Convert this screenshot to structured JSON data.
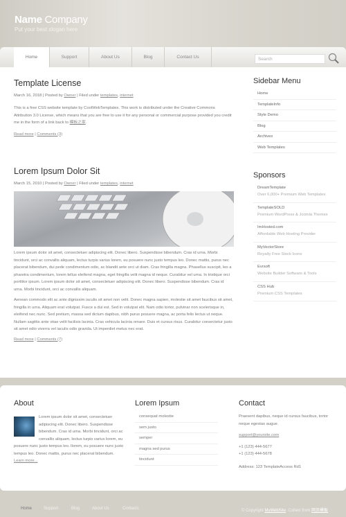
{
  "header": {
    "logo_bold": "Name",
    "logo_rest": " Company",
    "slogan": "Put your best slogan here"
  },
  "nav": {
    "items": [
      "Home",
      "Support",
      "About Us",
      "Blog",
      "Contact Us"
    ],
    "active": "Home",
    "search_placeholder": "Search"
  },
  "posts": [
    {
      "title": "Template License",
      "date": "March 16, 2018",
      "posted_by": "Posted by",
      "author": "Owner",
      "filed_under": "Filed under",
      "categories": [
        "templates",
        "internet"
      ],
      "body": [
        "This is a free CSS website template by CoolWebTemplates. This work is distributed under the Creative Commons Attribution 3.0 License, which means that you are free to use it for any personal or commercial purpose provided you credit me in the form of a link back to ",
        "模板之家",
        "."
      ],
      "read_more": "Read more",
      "comments": "Comments (3)"
    },
    {
      "title": "Lorem Ipsum Dolor Sit",
      "date": "March 15, 2010",
      "posted_by": "Posted by",
      "author": "Owner",
      "filed_under": "Filed under",
      "categories": [
        "templates",
        "internet"
      ],
      "paragraphs": [
        "Lorem ipsum dolor sit amet, consectetuer adipiscing elit. Donec libero. Suspendisse bibendum. Cras id urna. Morbi tincidunt, orci ac convallis aliquam, lectus turpis varius lorem, eu posuere nunc justo tempus leo. Donec mattis, purus nec placerat bibendum, dui pede condimentum odio, ac blandit ante orci ut diam. Cras fringilla magna. Phasellus suscipit, leo a pharetra condimentum, lorem tellus eleifend magna, eget fringilla velit magna id neque. Curabitur vel urna. In tristique orci porttitor ipsum. Lorem ipsum dolor sit amet, consectetuer adipiscing elit. Donec libero. Suspendisse bibendum. Cras id urna. Morbi tincidunt, orci ac convallis aliquam.",
        "Aenean commodo elit ac ante dignissim iaculis sit amet non velit. Donec magna sapien, molestie sit amet faucibus sit amet, fringilla in urna. Aliquam erat volutpat. Fusce a dui est. Sed in volutpat elit. Nam odio tortor, pulvinar non scelerisque in, eleifend nec nunc. Sed pretium, massa sed dictum dapibus, nibh purus posuere magna, ac porta felis lectus ut neque. Nullam sagittis ante vitae velit facilisis lacinia. Cras vehicula lacinia ornare. Duis et cursus risus. Curabitur consectetur justo sit amet odio viverra vel iaculis odio gravida. Ut imperdiet metus nec erat."
      ],
      "read_more": "Read more",
      "comments": "Comments (7)"
    }
  ],
  "sidebar": {
    "menu_title": "Sidebar Menu",
    "menu": [
      "Home",
      "TemplateInfo",
      "Style Demo",
      "Blog",
      "Archives",
      "Web Templates"
    ],
    "sponsors_title": "Sponsors",
    "sponsors": [
      {
        "name": "DreamTemplate",
        "desc": "Over 6,000+ Premium Web Templates"
      },
      {
        "name": "TemplateSOLD",
        "desc": "Premium WordPress & Joomla Themes"
      },
      {
        "name": "ImHosted.com",
        "desc": "Affordable Web Hosting Provider"
      },
      {
        "name": "MyVectorStore",
        "desc": "Royalty Free Stock Icons"
      },
      {
        "name": "Evrsoft",
        "desc": "Website Builder Software & Tools"
      },
      {
        "name": "CSS Hub",
        "desc": "Premium CSS Templates"
      }
    ]
  },
  "widgets": {
    "about": {
      "title": "About",
      "text": "Lorem ipsum dolor sit amet, consectetuer adipiscing elit. Donec libero. Suspendisse bibendum. Cras id urna. Morbi tincidunt, orci ac convallis aliquam, lectus turpis varius lorem, eu posuere nunc justo tempus leo. llorem, eu posuere nunc justo tempus leo. Donec mattis, purus nec placerat bibendum. ",
      "learn_more": "Learn more..."
    },
    "lorem": {
      "title": "Lorem Ipsum",
      "items": [
        "consequat molestie",
        "sem justo",
        "semper",
        "magna sed purus",
        "tincidunt"
      ]
    },
    "contact": {
      "title": "Contact",
      "text": "Praesent dapibus, neque id cursus faucibus, tortor neque egestas augue.",
      "email": "support@yoursite.com",
      "phone1": "+1 (123) 444-5677",
      "phone2": "+1 (123) 444-5678",
      "address": "Address: 123 TemplateAccess Rd1"
    }
  },
  "footer": {
    "nav": [
      "Home",
      "Support",
      "Blog",
      "About Us",
      "Contacts"
    ],
    "copyright": "© Copyright",
    "site": "MyWebSite",
    "collect": ". Collect from",
    "collect_link": "网页模板"
  }
}
